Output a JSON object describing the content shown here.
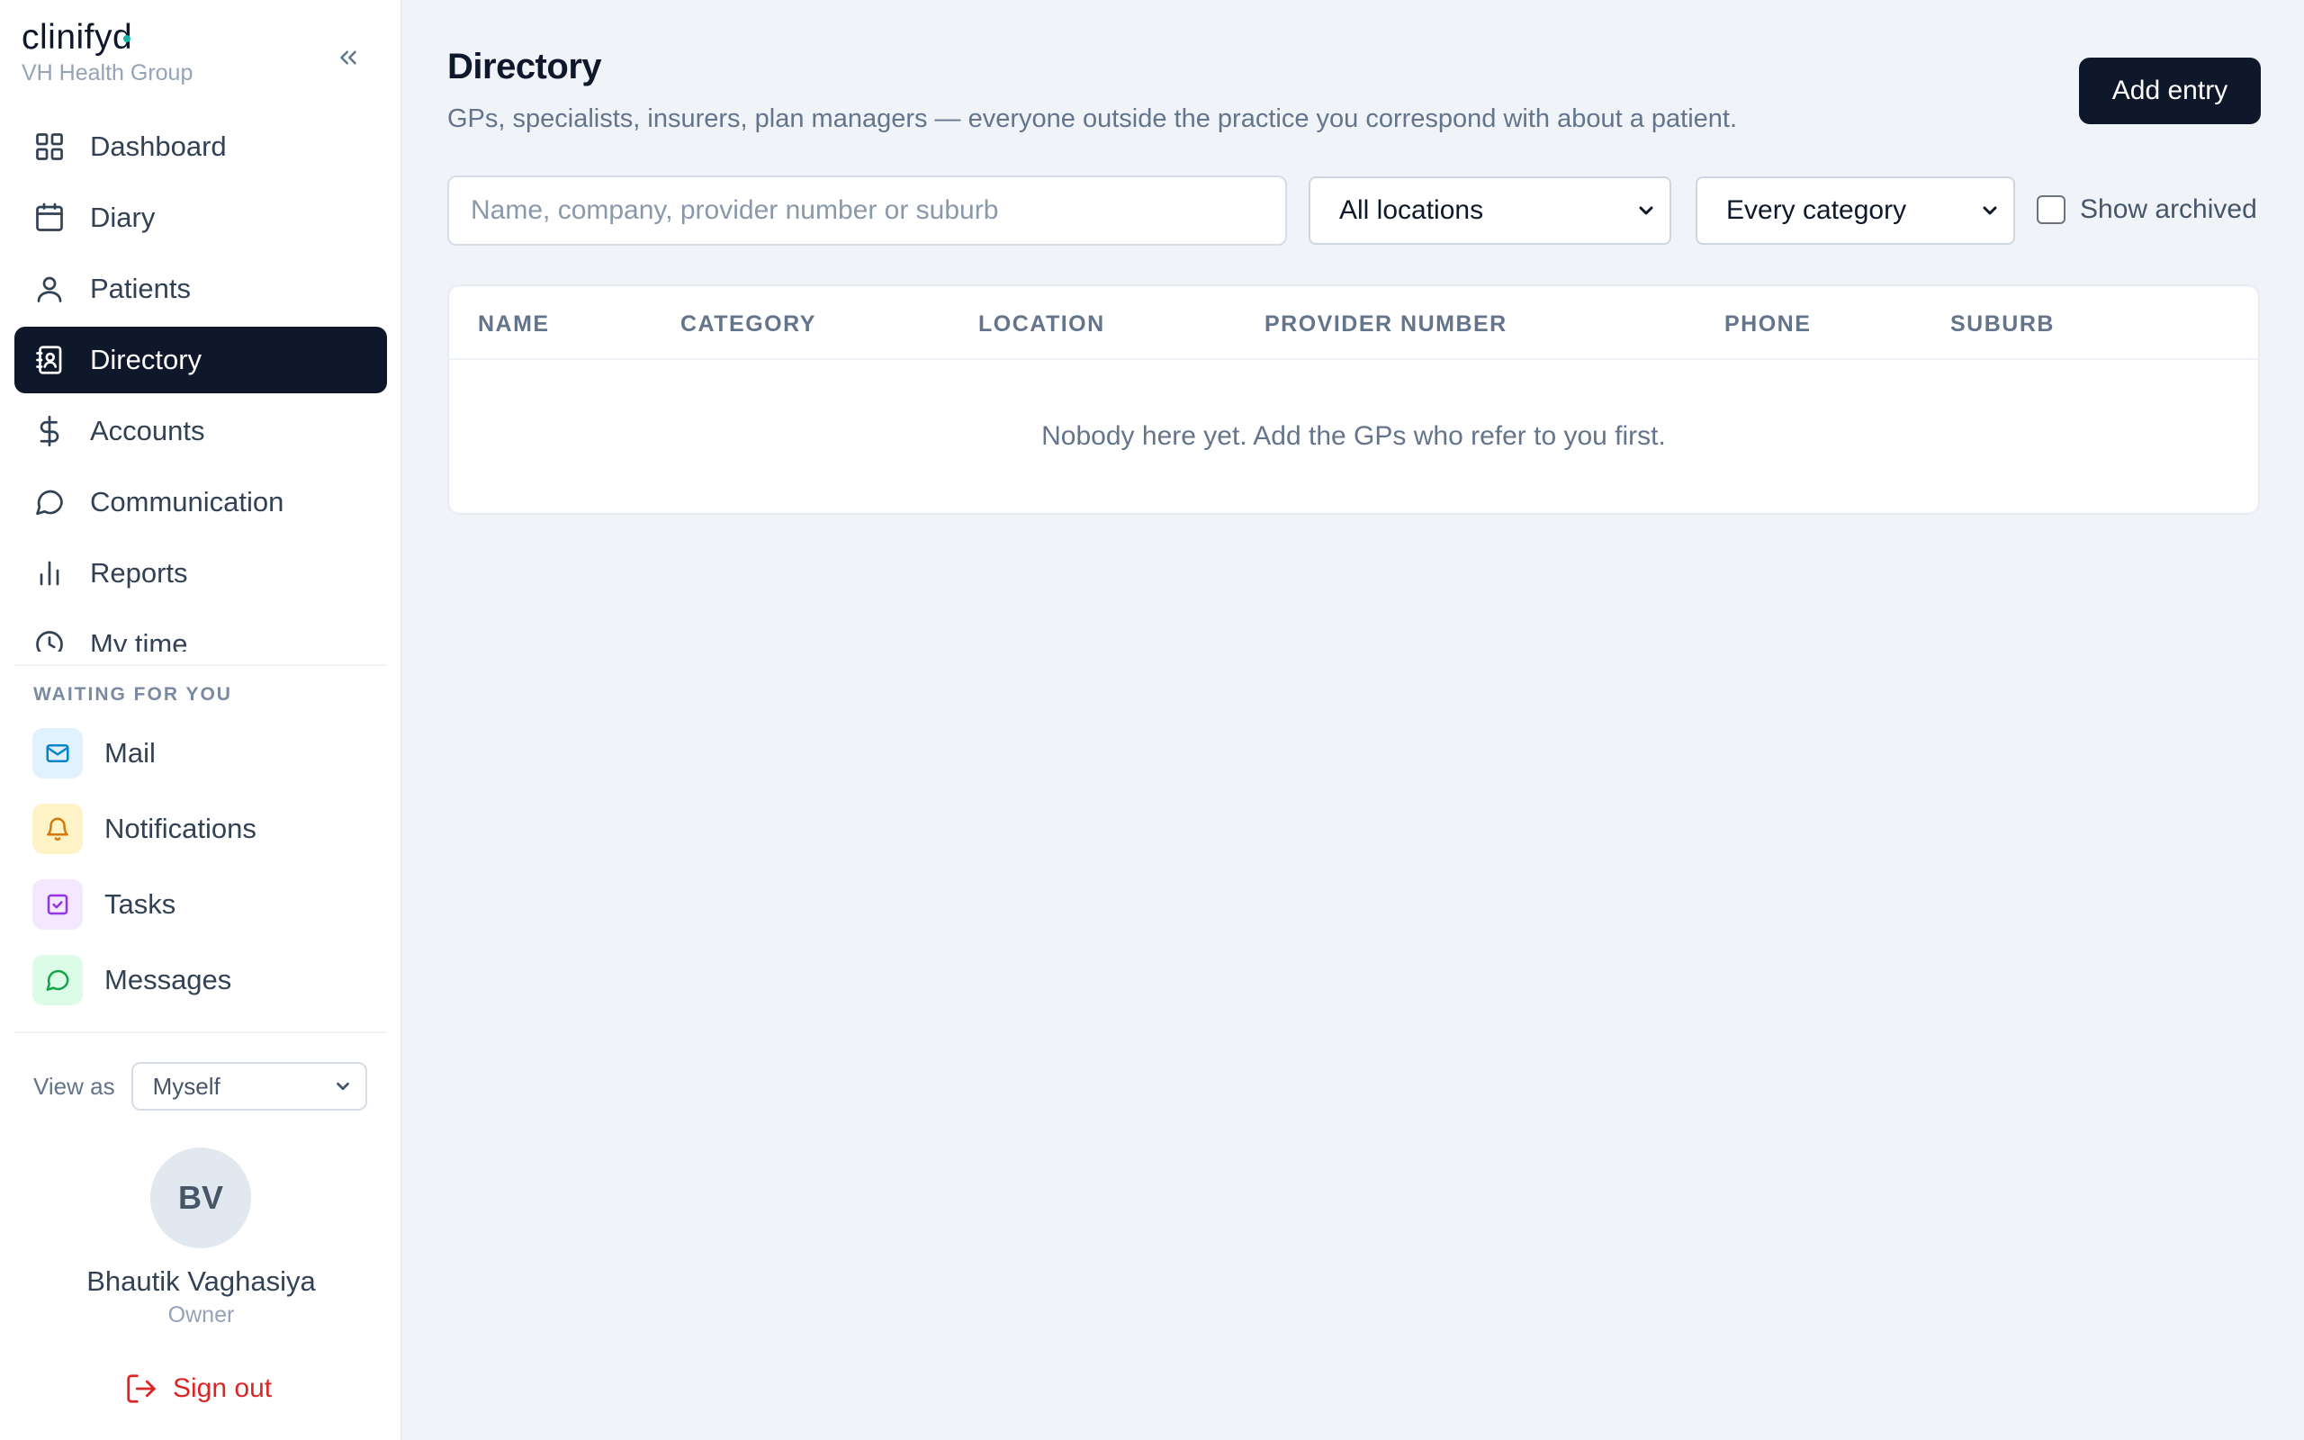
{
  "brand": {
    "logo": "clinifyd",
    "org": "VH Health Group"
  },
  "nav": {
    "items": [
      {
        "id": "dashboard",
        "label": "Dashboard",
        "icon": "grid-icon",
        "active": false
      },
      {
        "id": "diary",
        "label": "Diary",
        "icon": "calendar-icon",
        "active": false
      },
      {
        "id": "patients",
        "label": "Patients",
        "icon": "user-icon",
        "active": false
      },
      {
        "id": "directory",
        "label": "Directory",
        "icon": "contacts-book-icon",
        "active": true
      },
      {
        "id": "accounts",
        "label": "Accounts",
        "icon": "dollar-icon",
        "active": false
      },
      {
        "id": "communication",
        "label": "Communication",
        "icon": "chat-bubble-icon",
        "active": false
      },
      {
        "id": "reports",
        "label": "Reports",
        "icon": "bar-chart-icon",
        "active": false
      },
      {
        "id": "my-time",
        "label": "My time",
        "icon": "clock-icon",
        "active": false
      }
    ]
  },
  "waiting": {
    "label": "WAITING FOR YOU",
    "items": [
      {
        "label": "Mail",
        "icon": "mail-icon",
        "bg": "#e0f2fe",
        "color": "#0284c7"
      },
      {
        "label": "Notifications",
        "icon": "bell-icon",
        "bg": "#fef3c7",
        "color": "#d97706"
      },
      {
        "label": "Tasks",
        "icon": "task-check-icon",
        "bg": "#f3e8ff",
        "color": "#9333ea"
      },
      {
        "label": "Messages",
        "icon": "message-icon",
        "bg": "#dcfce7",
        "color": "#16a34a"
      }
    ]
  },
  "view_as": {
    "label": "View as",
    "value": "Myself"
  },
  "user": {
    "initials": "BV",
    "name": "Bhautik Vaghasiya",
    "role": "Owner"
  },
  "signout": {
    "label": "Sign out"
  },
  "page": {
    "title": "Directory",
    "description": "GPs, specialists, insurers, plan managers — everyone outside the practice you correspond with about a patient.",
    "add_label": "Add entry"
  },
  "filters": {
    "search_placeholder": "Name, company, provider number or suburb",
    "location": "All locations",
    "category": "Every category",
    "archived_label": "Show archived",
    "archived_checked": false
  },
  "table": {
    "columns": [
      "NAME",
      "CATEGORY",
      "LOCATION",
      "PROVIDER NUMBER",
      "PHONE",
      "SUBURB"
    ],
    "empty_message": "Nobody here yet. Add the GPs who refer to you first."
  },
  "colors": {
    "accent": "#0f172a",
    "background": "#f0f4f9",
    "danger": "#dc2626",
    "logo_dot": "#14b8a6"
  }
}
